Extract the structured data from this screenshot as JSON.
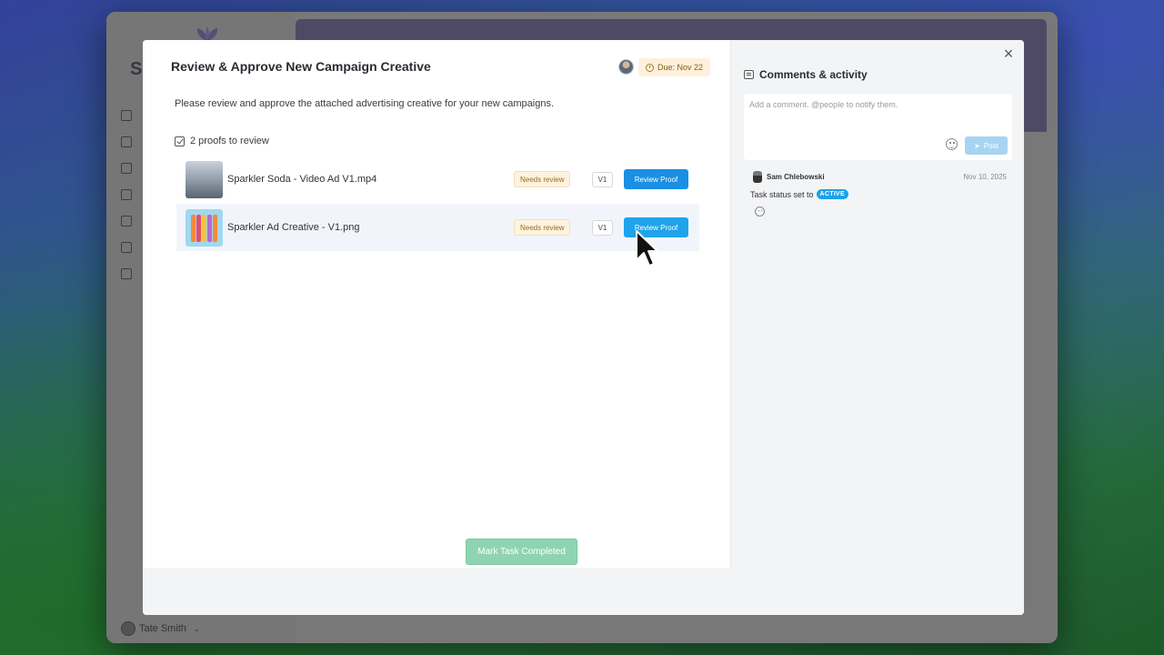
{
  "app": {
    "brand_initial": "S",
    "user_name": "Tate Smith"
  },
  "modal": {
    "title": "Review & Approve New Campaign Creative",
    "due": "Due: Nov 22",
    "description": "Please review and approve the attached advertising creative for your new campaigns.",
    "proofs_heading": "2 proofs to review",
    "proofs": [
      {
        "name": "Sparkler Soda - Video Ad V1.mp4",
        "status": "Needs review",
        "version": "V1",
        "action": "Review Proof"
      },
      {
        "name": "Sparkler Ad Creative - V1.png",
        "status": "Needs review",
        "version": "V1",
        "action": "Review Proof"
      }
    ],
    "complete_button": "Mark Task Completed",
    "close_symbol": "×"
  },
  "comments": {
    "heading": "Comments & activity",
    "placeholder": "Add a comment. @people to notify them.",
    "post_label": "Post",
    "activity": [
      {
        "author": "Sam Chlebowski",
        "date": "Nov 10, 2025",
        "text": "Task status set to",
        "status": "ACTIVE"
      }
    ]
  },
  "colors": {
    "primary": "#1a8fe3",
    "complete": "#8fd4b2",
    "active_pill": "#1aa3e8",
    "due_bg": "#fdf1dc"
  }
}
